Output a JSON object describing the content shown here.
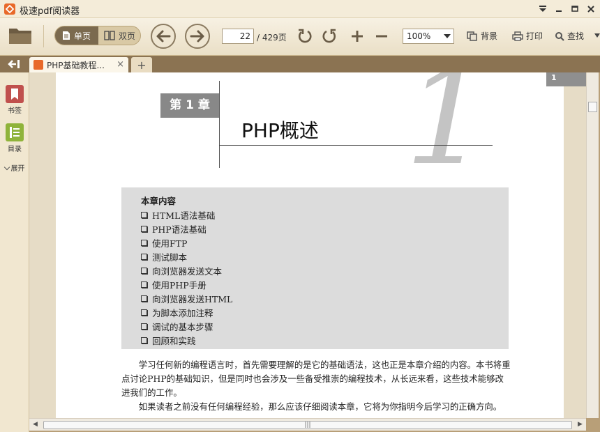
{
  "window": {
    "title": "极速pdf阅读器"
  },
  "toolbar": {
    "single_page": "单页",
    "double_page": "双页",
    "current_page": "22",
    "total_pages": "/ 429页",
    "zoom": "100%",
    "background": "背景",
    "print": "打印",
    "search": "查找"
  },
  "tab": {
    "label": "PHP基础教程...",
    "close": "×",
    "add": "+"
  },
  "leftpanel": {
    "bookmark": "书签",
    "toc": "目录",
    "expand": "展开"
  },
  "document": {
    "page_number": "1",
    "chapter_label": "第 1 章",
    "chapter_title": "PHP概述",
    "chapter_number_large": "1",
    "contents_title": "本章内容",
    "contents": [
      "HTML语法基础",
      "PHP语法基础",
      "使用FTP",
      "测试脚本",
      "向浏览器发送文本",
      "使用PHP手册",
      "向浏览器发送HTML",
      "为脚本添加注释",
      "调试的基本步骤",
      "回顾和实践"
    ],
    "paragraph1": "学习任何新的编程语言时，首先需要理解的是它的基础语法，这也正是本章介绍的内容。本书将重点讨论PHP的基础知识，但是同时也会涉及一些备受推崇的编程技术，从长远来看，这些技术能够改进我们的工作。",
    "paragraph2": "如果读者之前没有任何编程经验，那么应该仔细阅读本章，它将为你指明今后学习的正确方向。"
  },
  "colors": {
    "accent": "#e8692a",
    "toolbar_bg": "#f7f1e3",
    "tabbar_bg": "#8b7352"
  }
}
